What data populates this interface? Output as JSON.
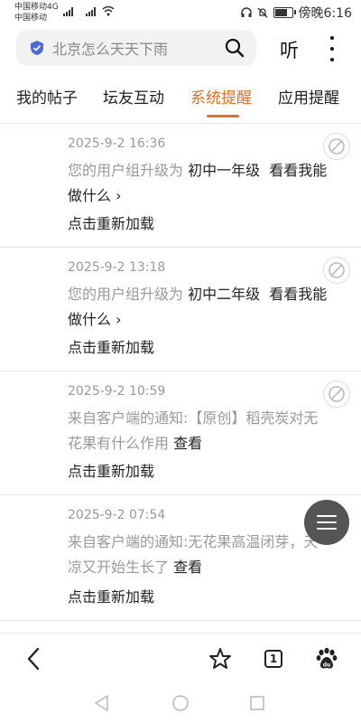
{
  "status_bar": {
    "carrier1": "中国移动4G",
    "carrier2": "中国移动",
    "sig1": "4G",
    "sig2": "E",
    "time": "傍晚6:16",
    "battery_level": 0.8
  },
  "search": {
    "text": "北京怎么天天下雨",
    "icon_shield": "shield-check-icon",
    "icon_search": "search-icon"
  },
  "header": {
    "listen_label": "听",
    "more_icon": "more-vertical-icon"
  },
  "tabs": [
    {
      "label": "我的帖子",
      "active": false
    },
    {
      "label": "坛友互动",
      "active": false
    },
    {
      "label": "系统提醒",
      "active": true
    },
    {
      "label": "应用提醒",
      "active": false
    }
  ],
  "accent_color": "#e66f22",
  "notifications": [
    {
      "time": "2025-9-2 16:36",
      "msg_prefix": "您的用户组升级为",
      "msg_highlight": "初中一年级",
      "msg_link": "看看我能做什么 ›",
      "reload": "点击重新加载"
    },
    {
      "time": "2025-9-2 13:18",
      "msg_prefix": "您的用户组升级为",
      "msg_highlight": "初中二年级",
      "msg_link": "看看我能做什么 ›",
      "reload": "点击重新加载"
    },
    {
      "time": "2025-9-2 10:59",
      "msg_prefix": "来自客户端的通知:【原创】稻壳炭对无花果有什么作用",
      "msg_link": "查看",
      "reload": "点击重新加载"
    },
    {
      "time": "2025-9-2 07:54",
      "msg_prefix": "来自客户端的通知:无花果高温闭芽，天凉又开始生长了",
      "msg_link": "查看",
      "reload": "点击重新加载"
    }
  ],
  "toolbar": {
    "back_icon": "back-arrow-icon",
    "favorite_icon": "star-icon",
    "tab_count": "1",
    "baidu_icon": "baidu-paw-icon"
  },
  "navbar": {
    "back": "triangle-back-icon",
    "home": "circle-home-icon",
    "recent": "square-recent-icon"
  }
}
